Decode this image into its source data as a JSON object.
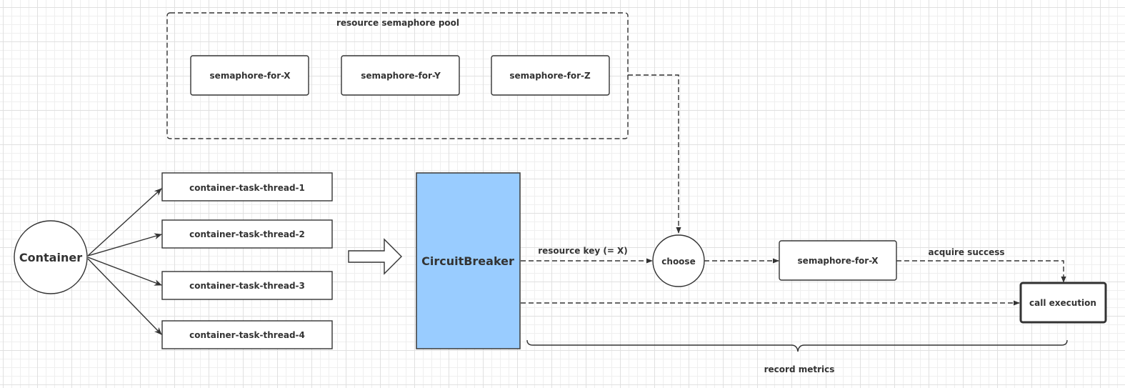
{
  "colors": {
    "stroke": "#333333",
    "circuit_breaker_fill": "#99ccff",
    "node_fill": "#ffffff",
    "grid_minor": "#efefef",
    "grid_major": "#e0e0e0"
  },
  "pool": {
    "title": "resource semaphore pool",
    "semaphores": [
      "semaphore-for-X",
      "semaphore-for-Y",
      "semaphore-for-Z"
    ]
  },
  "container": {
    "label": "Container"
  },
  "threads": [
    "container-task-thread-1",
    "container-task-thread-2",
    "container-task-thread-3",
    "container-task-thread-4"
  ],
  "circuit_breaker": {
    "label": "CircuitBreaker"
  },
  "choose": {
    "label": "choose"
  },
  "selected_semaphore": {
    "label": "semaphore-for-X"
  },
  "call_execution": {
    "label": "call execution"
  },
  "edges": {
    "resource_key": "resource key  (= X)",
    "acquire_success": "acquire success"
  },
  "brace": {
    "label": "record metrics"
  }
}
